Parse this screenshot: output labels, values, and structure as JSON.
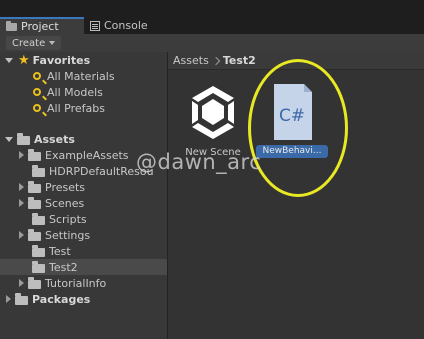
{
  "tabs": [
    {
      "label": "Project",
      "icon": "folder-icon",
      "active": true
    },
    {
      "label": "Console",
      "icon": "console-icon",
      "active": false
    }
  ],
  "toolbar": {
    "create_label": "Create"
  },
  "tree": {
    "favorites": {
      "label": "Favorites",
      "items": [
        "All Materials",
        "All Models",
        "All Prefabs"
      ]
    },
    "assets": {
      "label": "Assets",
      "items": [
        "ExampleAssets",
        "HDRPDefaultResou",
        "Presets",
        "Scenes",
        "Scripts",
        "Settings",
        "Test",
        "Test2",
        "TutorialInfo"
      ],
      "selected": "Test2"
    },
    "packages": {
      "label": "Packages"
    }
  },
  "breadcrumb": {
    "root": "Assets",
    "current": "Test2"
  },
  "items": [
    {
      "name": "New Scene",
      "icon": "unity-logo-icon"
    },
    {
      "name": "NewBehavi...",
      "icon": "csharp-script-icon",
      "icon_text": "C#",
      "selected": true
    }
  ],
  "watermark": "@dawn_arc",
  "colors": {
    "accent": "#3a6aa8",
    "highlight_circle": "#e8e825",
    "favorite_star": "#f0c020"
  }
}
